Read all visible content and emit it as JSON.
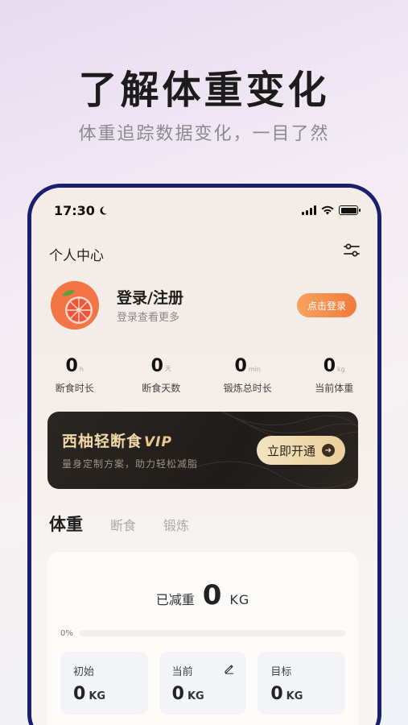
{
  "promo": {
    "headline": "了解体重变化",
    "subline": "体重追踪数据变化，一目了然"
  },
  "status_bar": {
    "time": "17:30"
  },
  "header": {
    "title": "个人中心",
    "settings_icon": "sliders-icon"
  },
  "profile": {
    "login_title": "登录/注册",
    "login_sub": "登录查看更多",
    "login_button": "点击登录"
  },
  "stats": [
    {
      "value": "0",
      "unit": "h",
      "label": "断食时长"
    },
    {
      "value": "0",
      "unit": "天",
      "label": "断食天数"
    },
    {
      "value": "0",
      "unit": "min",
      "label": "锻炼总时长"
    },
    {
      "value": "0",
      "unit": "kg",
      "label": "当前体重"
    }
  ],
  "vip": {
    "title": "西柚轻断食",
    "tag": "VIP",
    "subtitle": "量身定制方案，助力轻松减脂",
    "button": "立即开通"
  },
  "tabs": {
    "active": "体重",
    "items": [
      "断食",
      "锻炼"
    ]
  },
  "weight": {
    "lost_label": "已减重",
    "lost_value": "0",
    "lost_unit": "KG",
    "progress_text": "0%",
    "progress_fraction": 0,
    "metrics": [
      {
        "label": "初始",
        "value": "0",
        "unit": "KG"
      },
      {
        "label": "当前",
        "value": "0",
        "unit": "KG"
      },
      {
        "label": "目标",
        "value": "0",
        "unit": "KG"
      }
    ]
  },
  "colors": {
    "accent": "#f07a3c",
    "frame": "#1a1f6e",
    "vip_gold": "#f1d9a6"
  }
}
